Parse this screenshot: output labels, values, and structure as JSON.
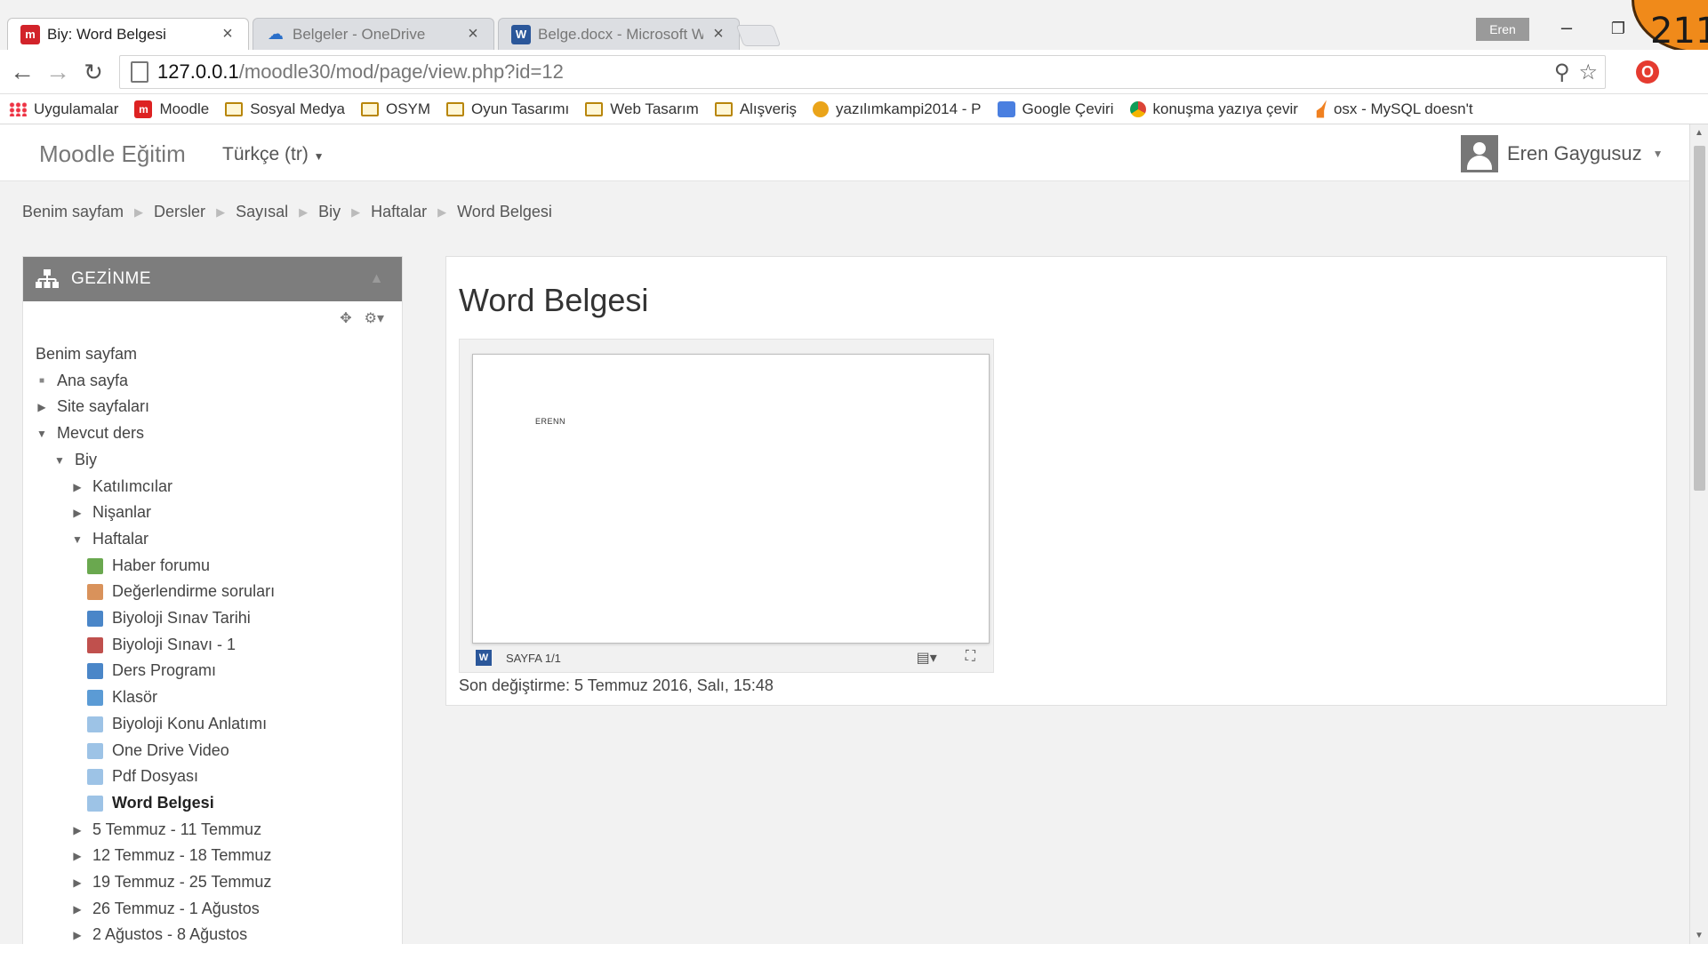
{
  "browser": {
    "tabs": [
      {
        "title": "Biy: Word Belgesi",
        "favicon": "moodle-icon",
        "active": true
      },
      {
        "title": "Belgeler - OneDrive",
        "favicon": "onedrive-icon",
        "active": false
      },
      {
        "title": "Belge.docx - Microsoft W",
        "favicon": "word-icon",
        "active": false
      }
    ],
    "profile_name": "Eren",
    "corner_number": "211",
    "url_host": "127.0.0.1",
    "url_path": "/moodle30/mod/page/view.php?id=12",
    "bookmarks": [
      {
        "label": "Uygulamalar",
        "icon": "apps-icon"
      },
      {
        "label": "Moodle",
        "icon": "moodle-icon"
      },
      {
        "label": "Sosyal Medya",
        "icon": "folder-icon"
      },
      {
        "label": "OSYM",
        "icon": "folder-icon"
      },
      {
        "label": "Oyun Tasarımı",
        "icon": "folder-icon"
      },
      {
        "label": "Web Tasarım",
        "icon": "folder-icon"
      },
      {
        "label": "Alışveriş",
        "icon": "folder-icon"
      },
      {
        "label": "yazılımkampi2014 - P",
        "icon": "tiger-icon"
      },
      {
        "label": "Google Çeviri",
        "icon": "google-translate-icon"
      },
      {
        "label": "konuşma yazıya çevir",
        "icon": "chrome-icon"
      },
      {
        "label": "osx - MySQL doesn't",
        "icon": "stackoverflow-icon"
      }
    ]
  },
  "moodle": {
    "brand": "Moodle Eğitim",
    "language": "Türkçe (tr)",
    "user_name": "Eren Gaygusuz",
    "breadcrumb": [
      "Benim sayfam",
      "Dersler",
      "Sayısal",
      "Biy",
      "Haftalar",
      "Word Belgesi"
    ],
    "nav_block": {
      "title": "GEZİNME",
      "items": [
        {
          "label": "Benim sayfam",
          "type": "plain"
        },
        {
          "label": "Ana sayfa",
          "type": "bullet"
        },
        {
          "label": "Site sayfaları",
          "type": "collapsed"
        },
        {
          "label": "Mevcut ders",
          "type": "expanded"
        },
        {
          "label": "Biy",
          "type": "expanded"
        },
        {
          "label": "Katılımcılar",
          "type": "collapsed"
        },
        {
          "label": "Nişanlar",
          "type": "collapsed"
        },
        {
          "label": "Haftalar",
          "type": "expanded"
        },
        {
          "label": "Haber forumu",
          "type": "resource",
          "icon": "forum-icon",
          "color": "#6aa84f"
        },
        {
          "label": "Değerlendirme soruları",
          "type": "resource",
          "icon": "feedback-icon",
          "color": "#d9925b"
        },
        {
          "label": "Biyoloji Sınav Tarihi",
          "type": "resource",
          "icon": "question-icon",
          "color": "#4a86c8"
        },
        {
          "label": "Biyoloji Sınavı - 1",
          "type": "resource",
          "icon": "quiz-icon",
          "color": "#c0504d"
        },
        {
          "label": "Ders Programı",
          "type": "resource",
          "icon": "url-icon",
          "color": "#4a86c8"
        },
        {
          "label": "Klasör",
          "type": "resource",
          "icon": "folder-icon",
          "color": "#5b9bd5"
        },
        {
          "label": "Biyoloji Konu Anlatımı",
          "type": "resource",
          "icon": "page-icon",
          "color": "#9dc3e6"
        },
        {
          "label": "One Drive Video",
          "type": "resource",
          "icon": "page-icon",
          "color": "#9dc3e6"
        },
        {
          "label": "Pdf Dosyası",
          "type": "resource",
          "icon": "page-icon",
          "color": "#9dc3e6"
        },
        {
          "label": "Word Belgesi",
          "type": "current",
          "icon": "page-icon",
          "color": "#9dc3e6"
        },
        {
          "label": "5 Temmuz - 11 Temmuz",
          "type": "collapsed"
        },
        {
          "label": "12 Temmuz - 18 Temmuz",
          "type": "collapsed"
        },
        {
          "label": "19 Temmuz - 25 Temmuz",
          "type": "collapsed"
        },
        {
          "label": "26 Temmuz - 1 Ağustos",
          "type": "collapsed"
        },
        {
          "label": "2 Ağustos - 8 Ağustos",
          "type": "collapsed"
        }
      ]
    },
    "page_title": "Word Belgesi",
    "doc_text": "ERENN",
    "viewer_page": "SAYFA 1/1",
    "last_modified": "Son değiştirme: 5 Temmuz 2016, Salı, 15:48"
  }
}
